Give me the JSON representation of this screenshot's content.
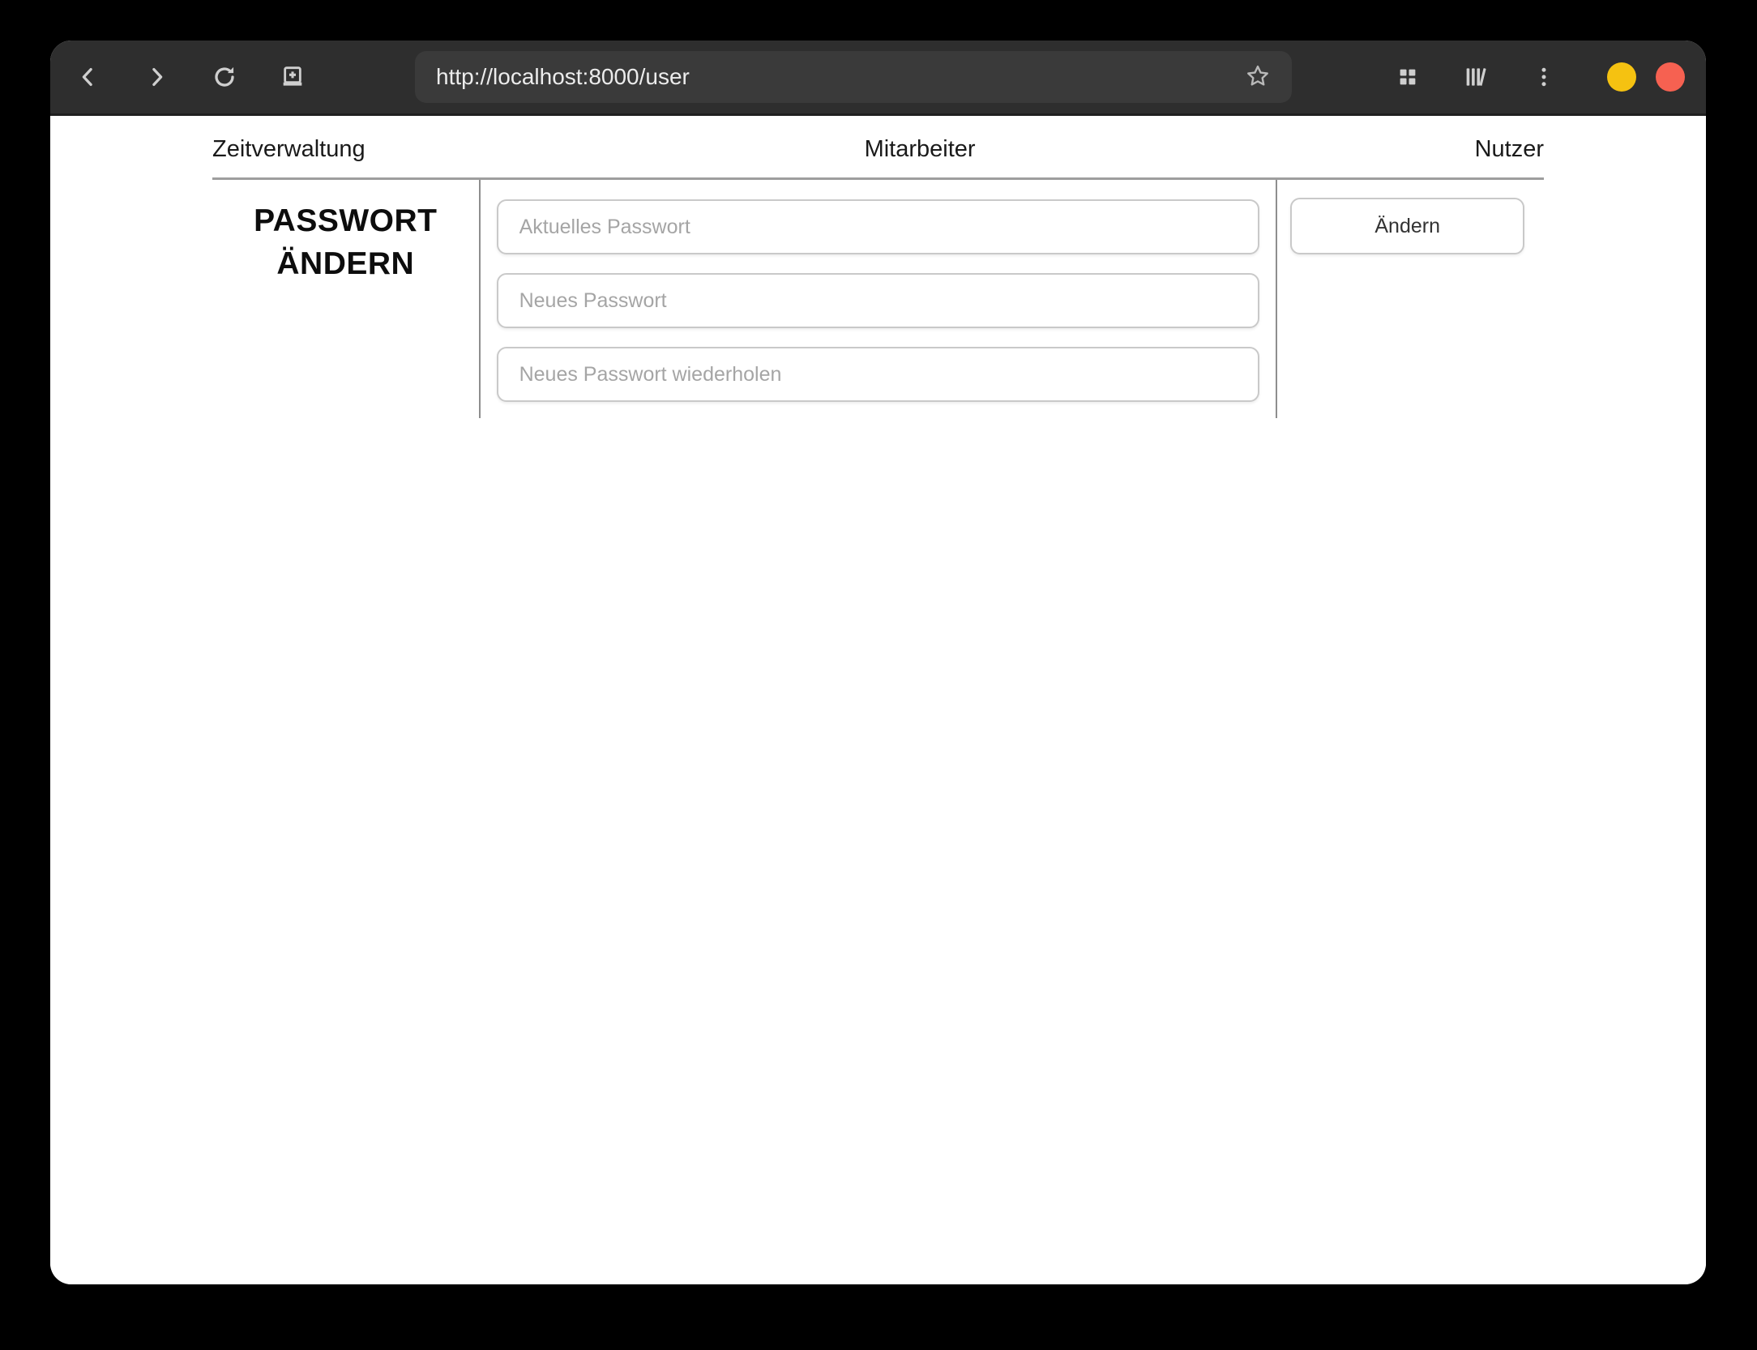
{
  "browser": {
    "url": "http://localhost:8000/user",
    "toolbar_icons": [
      "back-icon",
      "forward-icon",
      "reload-icon",
      "new-tab-icon",
      "bookmark-star-icon",
      "tab-grid-icon",
      "library-icon",
      "menu-kebab-icon"
    ],
    "window_controls": {
      "minimize_color": "#f5c211",
      "close_color": "#f66151"
    },
    "colors": {
      "toolbar_bg": "#2e2e2e",
      "urlbar_bg": "#3a3a3a",
      "icon": "#cfcfcf"
    }
  },
  "page": {
    "nav": [
      {
        "label": "Zeitverwaltung"
      },
      {
        "label": "Mitarbeiter"
      },
      {
        "label": "Nutzer"
      }
    ],
    "heading": "PASSWORT ÄNDERN",
    "form": {
      "fields": [
        {
          "placeholder": "Aktuelles Passwort"
        },
        {
          "placeholder": "Neues Passwort"
        },
        {
          "placeholder": "Neues Passwort wiederholen"
        }
      ],
      "submit_label": "Ändern"
    },
    "colors": {
      "divider": "#8e8e8e",
      "field_border": "#c9c9c9",
      "placeholder": "#a5a5a5"
    }
  }
}
